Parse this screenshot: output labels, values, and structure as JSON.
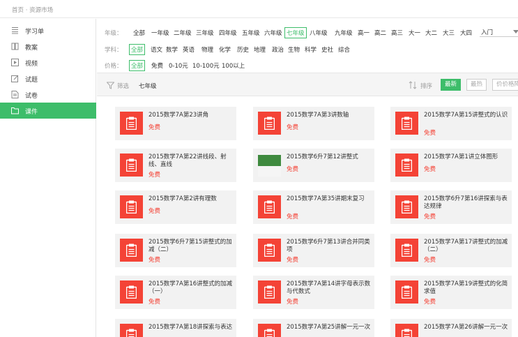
{
  "breadcrumb": "首页 · 资源市场",
  "sidebar": {
    "items": [
      {
        "label": "学习单",
        "icon": "list-icon"
      },
      {
        "label": "教案",
        "icon": "book-icon"
      },
      {
        "label": "视频",
        "icon": "video-icon"
      },
      {
        "label": "试题",
        "icon": "edit-icon"
      },
      {
        "label": "试卷",
        "icon": "document-icon"
      },
      {
        "label": "课件",
        "icon": "folder-icon",
        "active": true
      }
    ]
  },
  "filters": {
    "grade": {
      "label": "年级：",
      "options": [
        "全部",
        "一年级",
        "二年级",
        "三年级",
        "四年级",
        "五年级",
        "六年级",
        "七年级",
        "八年级",
        "九年级",
        "高一",
        "高二",
        "高三",
        "大一",
        "大二",
        "大三",
        "大四"
      ],
      "selected": "七年级",
      "dropdown": "入门"
    },
    "subject": {
      "label": "学科：",
      "options": [
        "全部",
        "语文",
        "数学",
        "英语",
        "物理",
        "化学",
        "历史",
        "地理",
        "政治",
        "生物",
        "科学",
        "史社",
        "综合"
      ],
      "selected": "全部"
    },
    "price": {
      "label": "价格：",
      "options": [
        "全部",
        "免费",
        "0-10元",
        "10-100元",
        "100以上"
      ],
      "selected": "全部"
    }
  },
  "toolbar": {
    "filter_label": "筛选",
    "current_grade": "七年级",
    "sort_label": "排序",
    "sort_buttons": [
      "最新",
      "最热",
      "价价格降"
    ]
  },
  "colors": {
    "accent": "#3dbd6a",
    "price": "#f44336"
  },
  "cards": [
    {
      "title": "2015数学7A第23讲角",
      "price": "免费"
    },
    {
      "title": "2015数学7A第3讲数轴",
      "price": "免费"
    },
    {
      "title": "2015数学7A第15讲整式的认识",
      "price": "免费"
    },
    {
      "title": "2015数学7A第22讲线段、射线、直线",
      "price": "免费"
    },
    {
      "title": "2015数学6升7第12讲整式",
      "price": "免费",
      "thumb": "image"
    },
    {
      "title": "2015数学7A第1讲立体图形",
      "price": "免费"
    },
    {
      "title": "2015数学7A第2讲有理数",
      "price": "免费"
    },
    {
      "title": "2015数学7A第35讲期末复习",
      "price": "免费"
    },
    {
      "title": "2015数学6升7第16讲探索与表达规律",
      "price": "免费"
    },
    {
      "title": "2015数学6升7第15讲整式的加减（二）",
      "price": "免费"
    },
    {
      "title": "2015数学6升7第13讲合并同类项",
      "price": "免费"
    },
    {
      "title": "2015数学7A第17讲整式的加减（二）",
      "price": "免费"
    },
    {
      "title": "2015数学7A第16讲整式的加减（一）",
      "price": "免费"
    },
    {
      "title": "2015数学7A第14讲字母表示数与代数式",
      "price": "免费"
    },
    {
      "title": "2015数学7A第19讲整式的化简求值",
      "price": "免费"
    },
    {
      "title": "2015数学7A第18讲探索与表达",
      "price": ""
    },
    {
      "title": "2015数学7A第25讲解一元一次",
      "price": ""
    },
    {
      "title": "2015数学7A第26讲解一元一次",
      "price": ""
    }
  ]
}
